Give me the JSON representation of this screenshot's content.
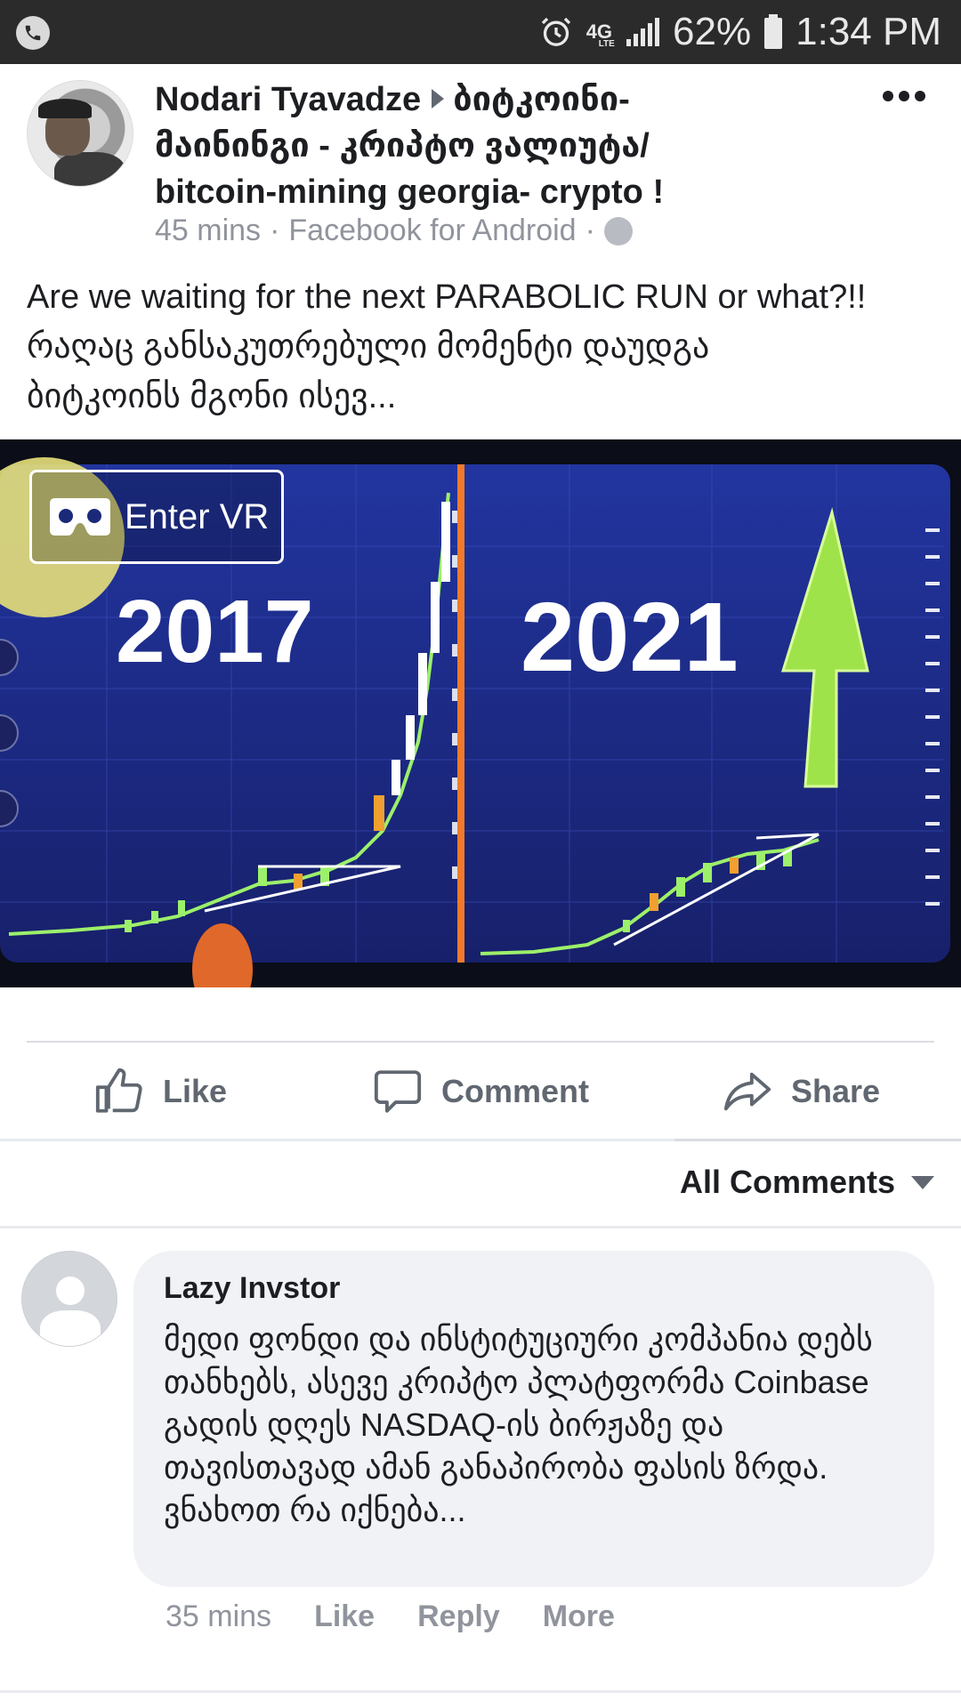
{
  "status_bar": {
    "network": "4G",
    "network_sub": "LTE",
    "battery": "62%",
    "time": "1:34 PM"
  },
  "post": {
    "author": "Nodari Tyavadze",
    "group_line1": "ბიტკოინი-",
    "group_line2": "მაინინგი - კრიპტო ვალიუტა/",
    "group_line3": "bitcoin-mining georgia- crypto !",
    "time": "45 mins",
    "source": "Facebook for Android",
    "separator": "·",
    "text_line1": "Are we waiting for the next PARABOLIC RUN or what?!!",
    "text_line2": "რაღაც განსაკუთრებული მომენტი დაუდგა",
    "text_line3": "ბიტკოინს მგონი ისევ..."
  },
  "media": {
    "enter_vr_label": "Enter VR",
    "label_left": "2017",
    "label_right": "2021"
  },
  "actions": {
    "like": "Like",
    "comment": "Comment",
    "share": "Share"
  },
  "comments_filter": "All Comments",
  "comment": {
    "name": "Lazy Invstor",
    "text": "მედი ფონდი და ინსტიტუციური კომპანია დებს თანხებს, ასევე კრიპტო პლატფორმა Coinbase გადის დღეს NASDAQ-ის ბირჟაზე და თავისთავად ამან განაპირობა ფასის ზრდა. ვნახოთ რა იქნება...",
    "time": "35 mins",
    "like": "Like",
    "reply": "Reply",
    "more": "More"
  },
  "colors": {
    "status_bg": "#2b2b2b",
    "text_primary": "#1c1e21",
    "text_secondary": "#90949c",
    "bubble_bg": "#f0f2f5",
    "chart_bg": "#1b2a78",
    "arrow_green": "#9fe34a"
  }
}
